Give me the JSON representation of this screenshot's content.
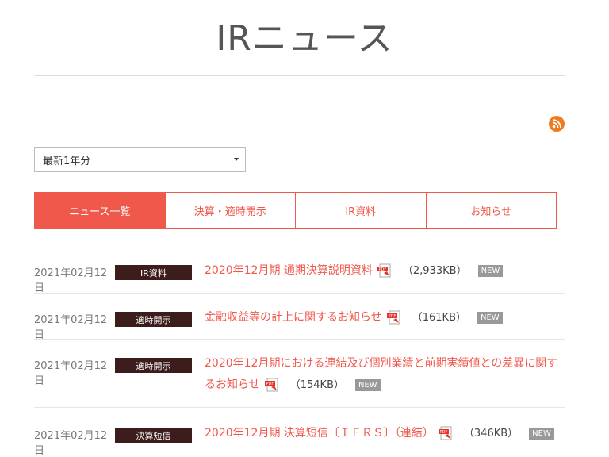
{
  "header": {
    "title": "IRニュース"
  },
  "filter": {
    "selected": "最新1年分"
  },
  "tabs": [
    {
      "label": "ニュース一覧",
      "active": true
    },
    {
      "label": "決算・適時開示",
      "active": false
    },
    {
      "label": "IR資料",
      "active": false
    },
    {
      "label": "お知らせ",
      "active": false
    }
  ],
  "news": [
    {
      "date": "2021年02月12日",
      "category": "IR資料",
      "title": "2020年12月期 通期決算説明資料",
      "size": "（2,933KB）",
      "badge": "NEW"
    },
    {
      "date": "2021年02月12日",
      "category": "適時開示",
      "title": "金融収益等の計上に関するお知らせ",
      "size": "（161KB）",
      "badge": "NEW"
    },
    {
      "date": "2021年02月12日",
      "category": "適時開示",
      "title": "2020年12月期における連結及び個別業績と前期実績値との差異に関するお知らせ",
      "size": "（154KB）",
      "badge": "NEW"
    },
    {
      "date": "2021年02月12日",
      "category": "決算短信",
      "title": "2020年12月期 決算短信〔ＩＦＲＳ〕（連結）",
      "size": "（346KB）",
      "badge": "NEW"
    }
  ],
  "colors": {
    "accent": "#f0584b",
    "badge_bg": "#3d1c1c",
    "rss": "#f07b1e"
  }
}
